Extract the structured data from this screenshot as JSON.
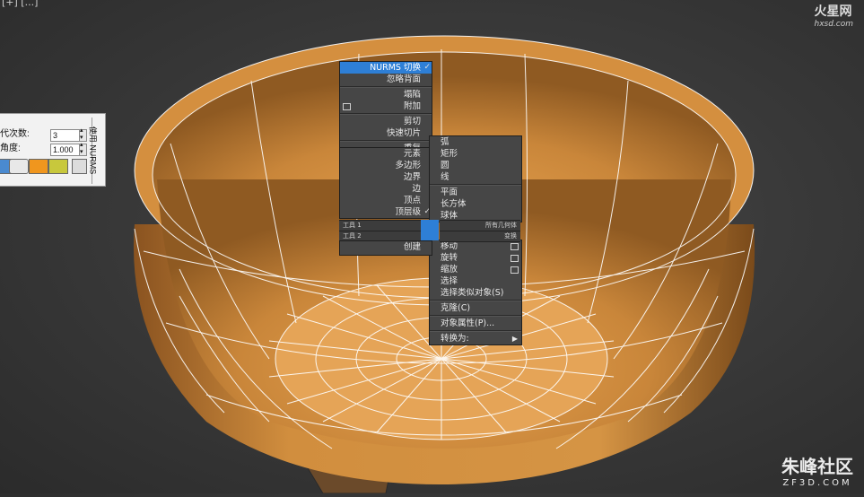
{
  "viewport": {
    "top_label": "[+] [...]"
  },
  "left_panel": {
    "iterations_label": "代次数:",
    "iterations_value": "3",
    "smoothness_label": "角度:",
    "smoothness_value": "1.000",
    "vertical_tab": "使用 NURMS",
    "swatch_orange": "#f0961e",
    "swatch_yellow": "#c8c83c"
  },
  "quad_menu": {
    "left_top": [
      {
        "label": "NURMS 切换",
        "checked": true,
        "highlight": true
      },
      {
        "label": "忽略背面"
      },
      {
        "sep": true
      },
      {
        "label": "塌陷"
      },
      {
        "label": "附加",
        "box": true
      },
      {
        "sep": true
      },
      {
        "label": "剪切"
      },
      {
        "label": "快速切片"
      },
      {
        "sep": true
      },
      {
        "label": "重复"
      }
    ],
    "left_bottom": [
      {
        "label": "元素"
      },
      {
        "label": "多边形"
      },
      {
        "label": "边界"
      },
      {
        "label": "边"
      },
      {
        "label": "顶点"
      },
      {
        "label": "顶层级",
        "checked": true
      }
    ],
    "right_top": [
      {
        "label": "弧"
      },
      {
        "label": "矩形"
      },
      {
        "label": "圆"
      },
      {
        "label": "线"
      },
      {
        "sep": true
      },
      {
        "label": "平面"
      },
      {
        "label": "长方体"
      },
      {
        "label": "球体"
      }
    ],
    "right_bottom": [
      {
        "label": "移动",
        "box": true
      },
      {
        "label": "旋转",
        "box": true
      },
      {
        "label": "缩放",
        "box": true
      },
      {
        "label": "选择"
      },
      {
        "label": "选择类似对象(S)"
      },
      {
        "sep": true
      },
      {
        "label": "克隆(C)"
      },
      {
        "sep": true
      },
      {
        "label": "对象属性(P)..."
      },
      {
        "sep": true
      },
      {
        "label": "转换为:",
        "arrow": true
      }
    ],
    "bar_tools1": "工具 1",
    "bar_tools2": "工具 2",
    "bar_right1": "所有几何体",
    "bar_right2": "变换",
    "create_label": "创建"
  },
  "logos": {
    "top_right_title": "火星网",
    "top_right_url": "hxsd.com",
    "bottom_right_title": "朱峰社区",
    "bottom_right_url": "ZF3D.COM"
  },
  "colors": {
    "accent": "#2e7fd6",
    "bowl": "#d9913c",
    "wire": "#ffffff"
  }
}
